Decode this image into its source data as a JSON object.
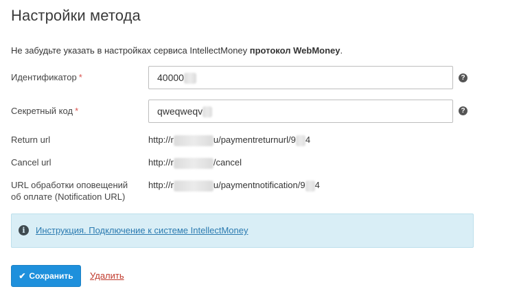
{
  "page": {
    "title": "Настройки метода",
    "notice_prefix": "Не забудьте указать в настройках сервиса IntellectMoney ",
    "notice_bold": "протокол WebMoney",
    "notice_suffix": "."
  },
  "form": {
    "identifier": {
      "label": "Идентификатор",
      "required_mark": "*",
      "value": "40000"
    },
    "secret": {
      "label": "Секретный код",
      "required_mark": "*",
      "value": "qweqweqv"
    },
    "help_glyph": "?",
    "return_url": {
      "label": "Return url",
      "prefix": "http://r",
      "middle": "u/paymentreturnurl/9",
      "suffix": "4"
    },
    "cancel_url": {
      "label": "Cancel url",
      "prefix": "http://r",
      "suffix": "/cancel"
    },
    "notification_url": {
      "label_line1": "URL обработки оповещений",
      "label_line2": "об оплате (Notification URL)",
      "prefix": "http://r",
      "middle": "u/paymentnotification/9",
      "suffix": "4"
    }
  },
  "info": {
    "icon": "info-icon",
    "glyph": "i",
    "link_text": "Инструкция. Подключение к системе IntellectMoney"
  },
  "actions": {
    "save_label": "Сохранить",
    "delete_label": "Удалить"
  },
  "colors": {
    "primary": "#1e90dc",
    "info_bg": "#d9eef6",
    "link": "#2a7ab0",
    "danger": "#c0392b",
    "required": "#d9534f"
  }
}
